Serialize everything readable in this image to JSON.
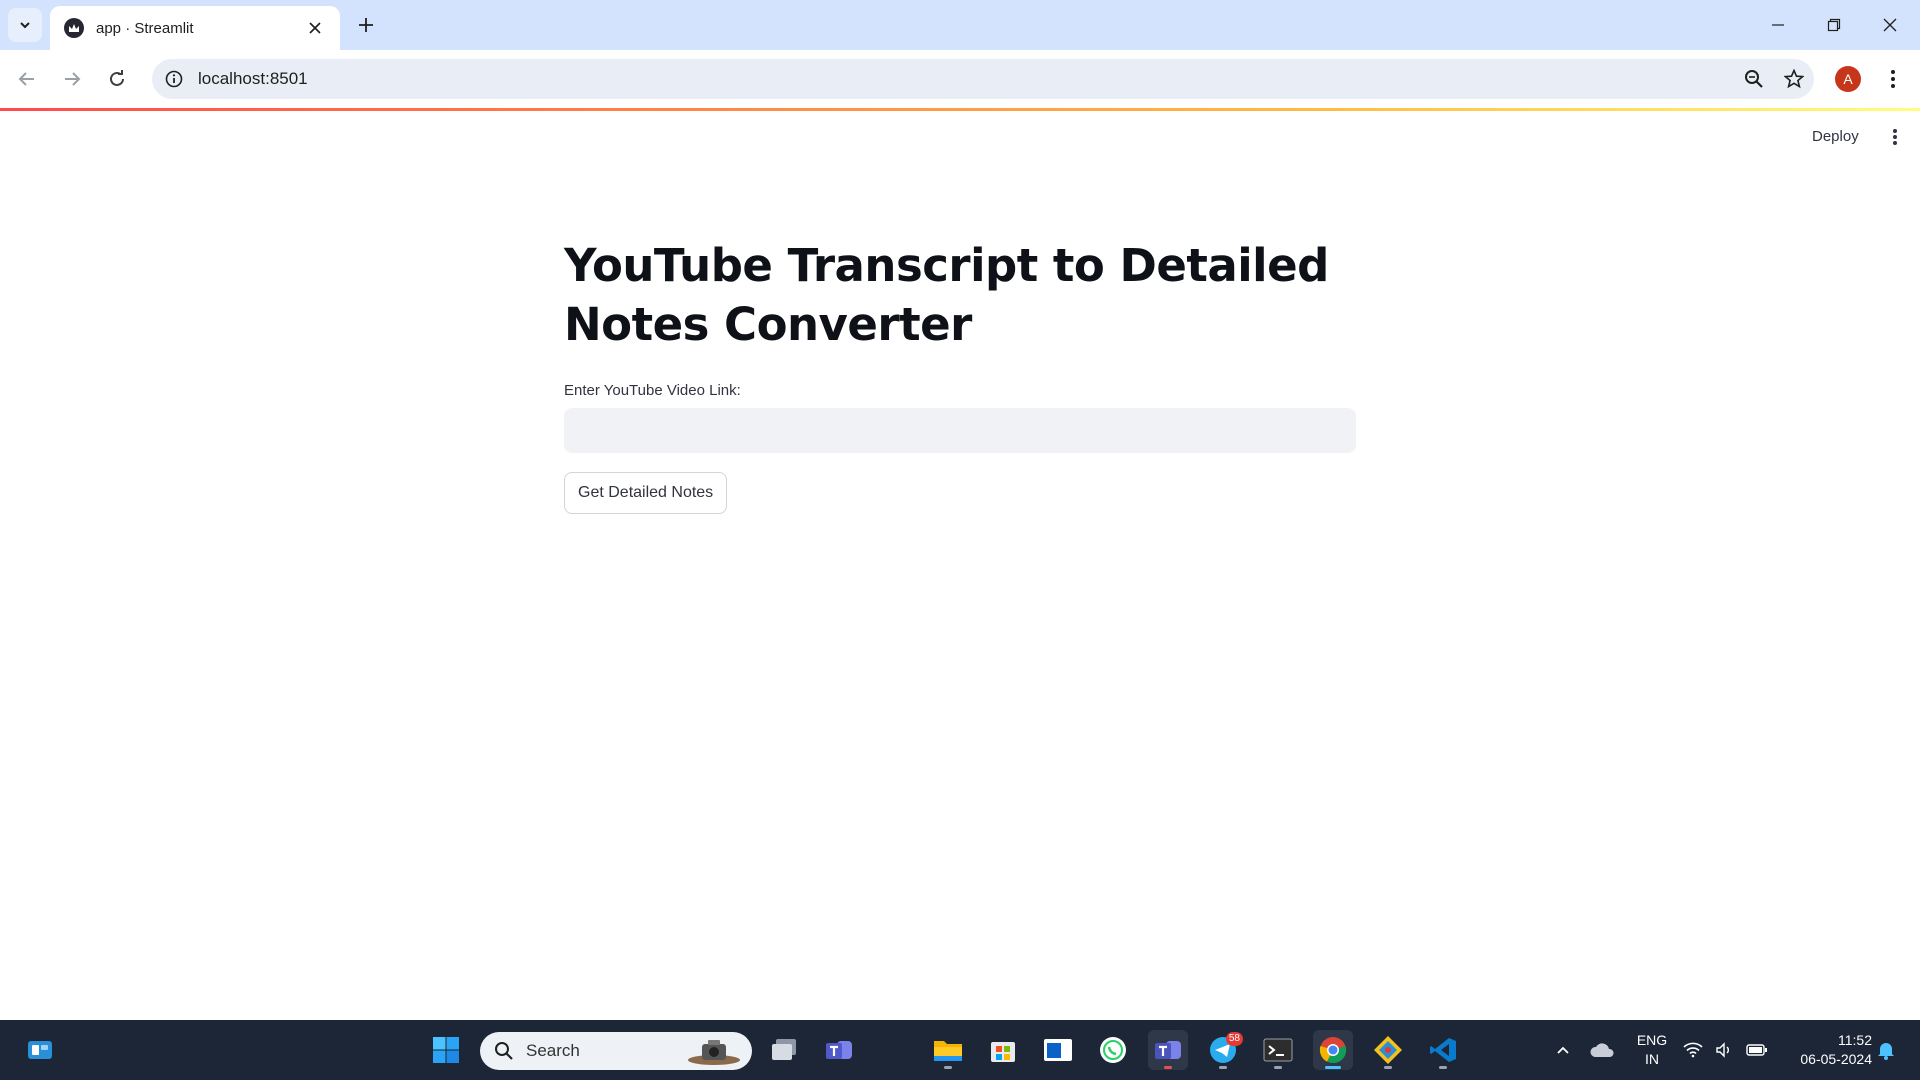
{
  "browser": {
    "tab_title": "app · Streamlit",
    "url": "localhost:8501",
    "profile_initial": "A"
  },
  "header": {
    "deploy_label": "Deploy"
  },
  "main": {
    "title": "YouTube Transcript to Detailed Notes Converter",
    "input_label": "Enter YouTube Video Link:",
    "input_value": "",
    "button_label": "Get Detailed Notes"
  },
  "taskbar": {
    "search_label": "Search",
    "telegram_badge": "58",
    "language_line1": "ENG",
    "language_line2": "IN",
    "time": "11:52",
    "date": "06-05-2024"
  },
  "colors": {
    "accent": "#ff4b4b",
    "title": "#0e1117",
    "input_bg": "#f0f2f6"
  }
}
